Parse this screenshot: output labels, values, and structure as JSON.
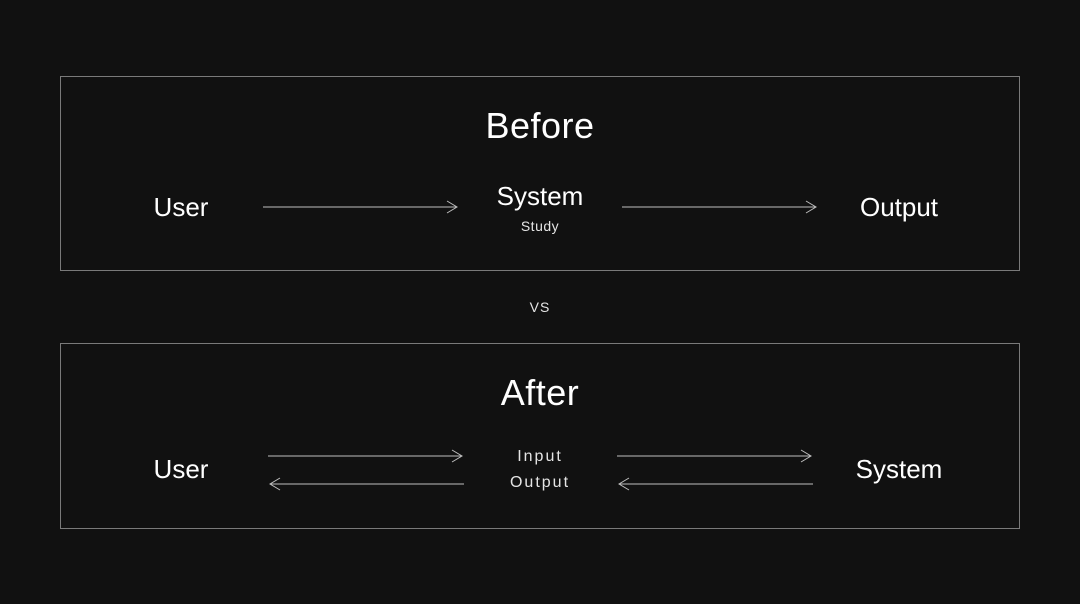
{
  "before": {
    "title": "Before",
    "left": "User",
    "center": "System",
    "centerSub": "Study",
    "right": "Output"
  },
  "vs": "VS",
  "after": {
    "title": "After",
    "left": "User",
    "midTop": "Input",
    "midBottom": "Output",
    "right": "System"
  }
}
